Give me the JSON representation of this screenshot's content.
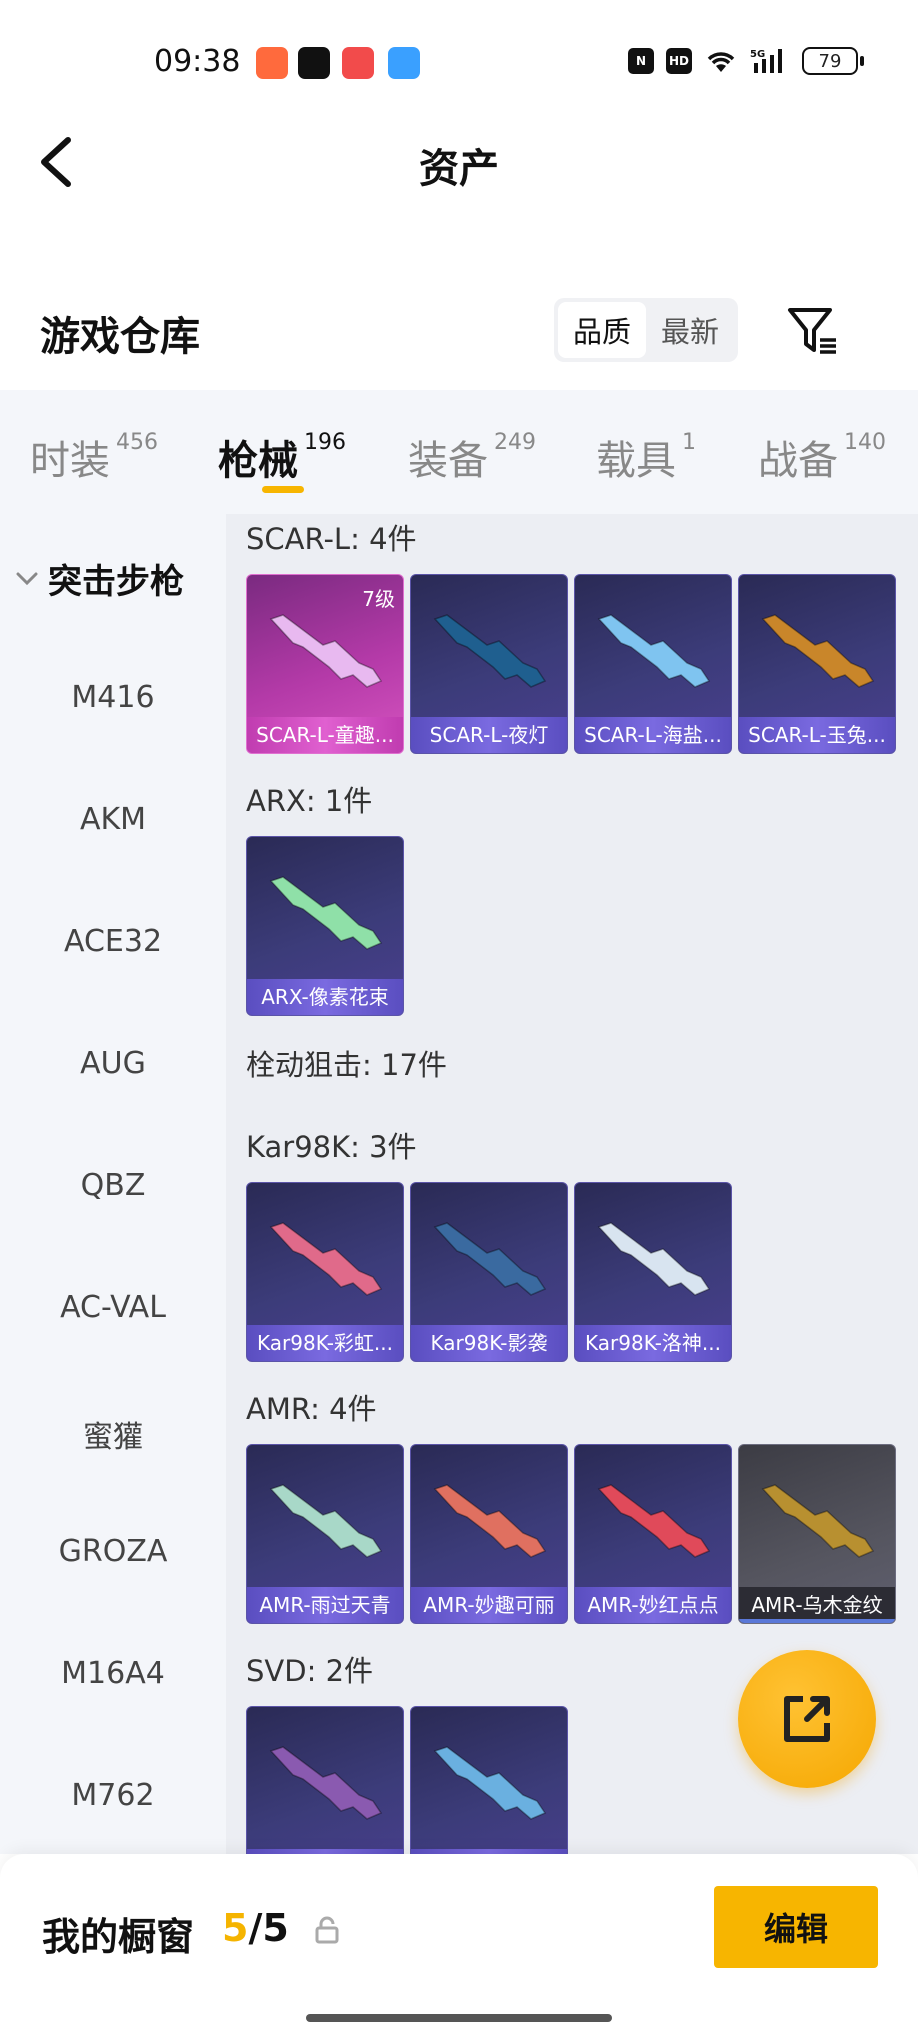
{
  "status_bar": {
    "time": "09:38",
    "battery": "79",
    "hd": "HD",
    "net": "5G"
  },
  "header": {
    "title": "资产"
  },
  "warehouse": {
    "title": "游戏仓库",
    "sort_options": [
      "品质",
      "最新"
    ],
    "active_sort": "品质"
  },
  "tabs": [
    {
      "label": "时装",
      "count": "456"
    },
    {
      "label": "枪械",
      "count": "196"
    },
    {
      "label": "装备",
      "count": "249"
    },
    {
      "label": "载具",
      "count": "1"
    },
    {
      "label": "战备",
      "count": "140"
    }
  ],
  "active_tab": "枪械",
  "sidebar": {
    "category": "突击步枪",
    "items": [
      "M416",
      "AKM",
      "ACE32",
      "AUG",
      "QBZ",
      "AC-VAL",
      "蜜獾",
      "GROZA",
      "M16A4",
      "M762"
    ]
  },
  "groups": [
    {
      "title": "SCAR-L: 4件"
    },
    {
      "title": "ARX: 1件"
    },
    {
      "title": "栓动狙击: 17件"
    },
    {
      "title": "Kar98K: 3件"
    },
    {
      "title": "AMR: 4件"
    },
    {
      "title": "SVD: 2件"
    }
  ],
  "cards": {
    "scar": [
      {
        "name": "SCAR-L-童趣...",
        "level": "7级",
        "gun_color": "#e8b9f0"
      },
      {
        "name": "SCAR-L-夜灯",
        "gun_color": "#1f5f8f"
      },
      {
        "name": "SCAR-L-海盐...",
        "gun_color": "#7fc4f0"
      },
      {
        "name": "SCAR-L-玉兔...",
        "gun_color": "#c9862a"
      }
    ],
    "arx": [
      {
        "name": "ARX-像素花束",
        "gun_color": "#8fe0a8"
      }
    ],
    "kar": [
      {
        "name": "Kar98K-彩虹...",
        "gun_color": "#e06a8a"
      },
      {
        "name": "Kar98K-影袭",
        "gun_color": "#3a6aa0"
      },
      {
        "name": "Kar98K-洛神...",
        "gun_color": "#d8e4f0"
      }
    ],
    "amr": [
      {
        "name": "AMR-雨过天青",
        "gun_color": "#a8d8c8"
      },
      {
        "name": "AMR-妙趣可丽",
        "gun_color": "#e07060"
      },
      {
        "name": "AMR-妙红点点",
        "gun_color": "#e04a5a"
      },
      {
        "name": "AMR-乌木金纹",
        "gun_color": "#b89030"
      }
    ],
    "svd": [
      {
        "name": "",
        "gun_color": "#8a5ab0"
      },
      {
        "name": "",
        "gun_color": "#6ab0e0"
      }
    ]
  },
  "showcase": {
    "label": "我的橱窗",
    "current": "5",
    "separator": "/",
    "total": "5",
    "edit_label": "编辑"
  },
  "colors": {
    "accent": "#f7b500",
    "card_border": "#5b54a8"
  }
}
